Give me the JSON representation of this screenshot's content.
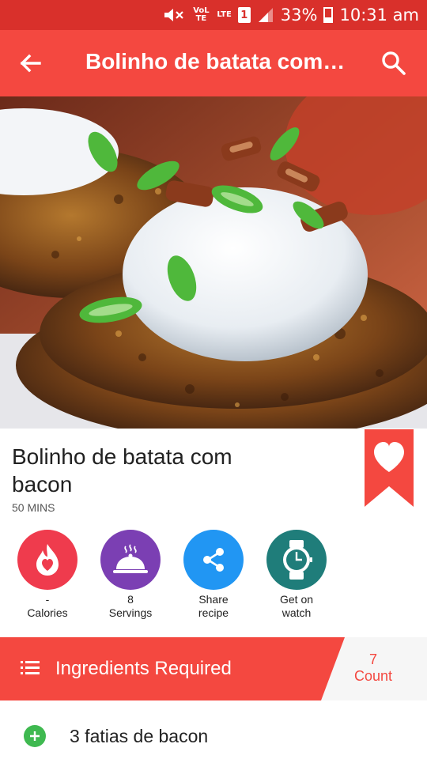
{
  "status_bar": {
    "volte": "VoLTE",
    "lte": "LTE",
    "sim": "1",
    "battery": "33%",
    "time": "10:31 am"
  },
  "app_bar": {
    "title": "Bolinho de batata com…",
    "back_icon": "back-arrow-icon",
    "search_icon": "search-icon"
  },
  "recipe": {
    "title": "Bolinho de batata com bacon",
    "duration": "50 MINS",
    "favorite_icon": "heart-icon"
  },
  "actions": [
    {
      "value": "-",
      "label": "Calories",
      "icon": "flame-icon",
      "color": "#ef3b4d"
    },
    {
      "value": "8",
      "label": "Servings",
      "icon": "cloche-icon",
      "color": "#7b3fb3"
    },
    {
      "value": "Share",
      "label": "recipe",
      "icon": "share-icon",
      "color": "#2196f3"
    },
    {
      "value": "Get on",
      "label": "watch",
      "icon": "watch-icon",
      "color": "#1f7d7a"
    }
  ],
  "ingredients": {
    "header": "Ingredients Required",
    "count_value": "7",
    "count_label": "Count",
    "items": [
      {
        "text": "3 fatias de bacon"
      }
    ]
  },
  "colors": {
    "primary": "#f44840",
    "status_bar": "#d9302b",
    "add": "#3fb950"
  }
}
